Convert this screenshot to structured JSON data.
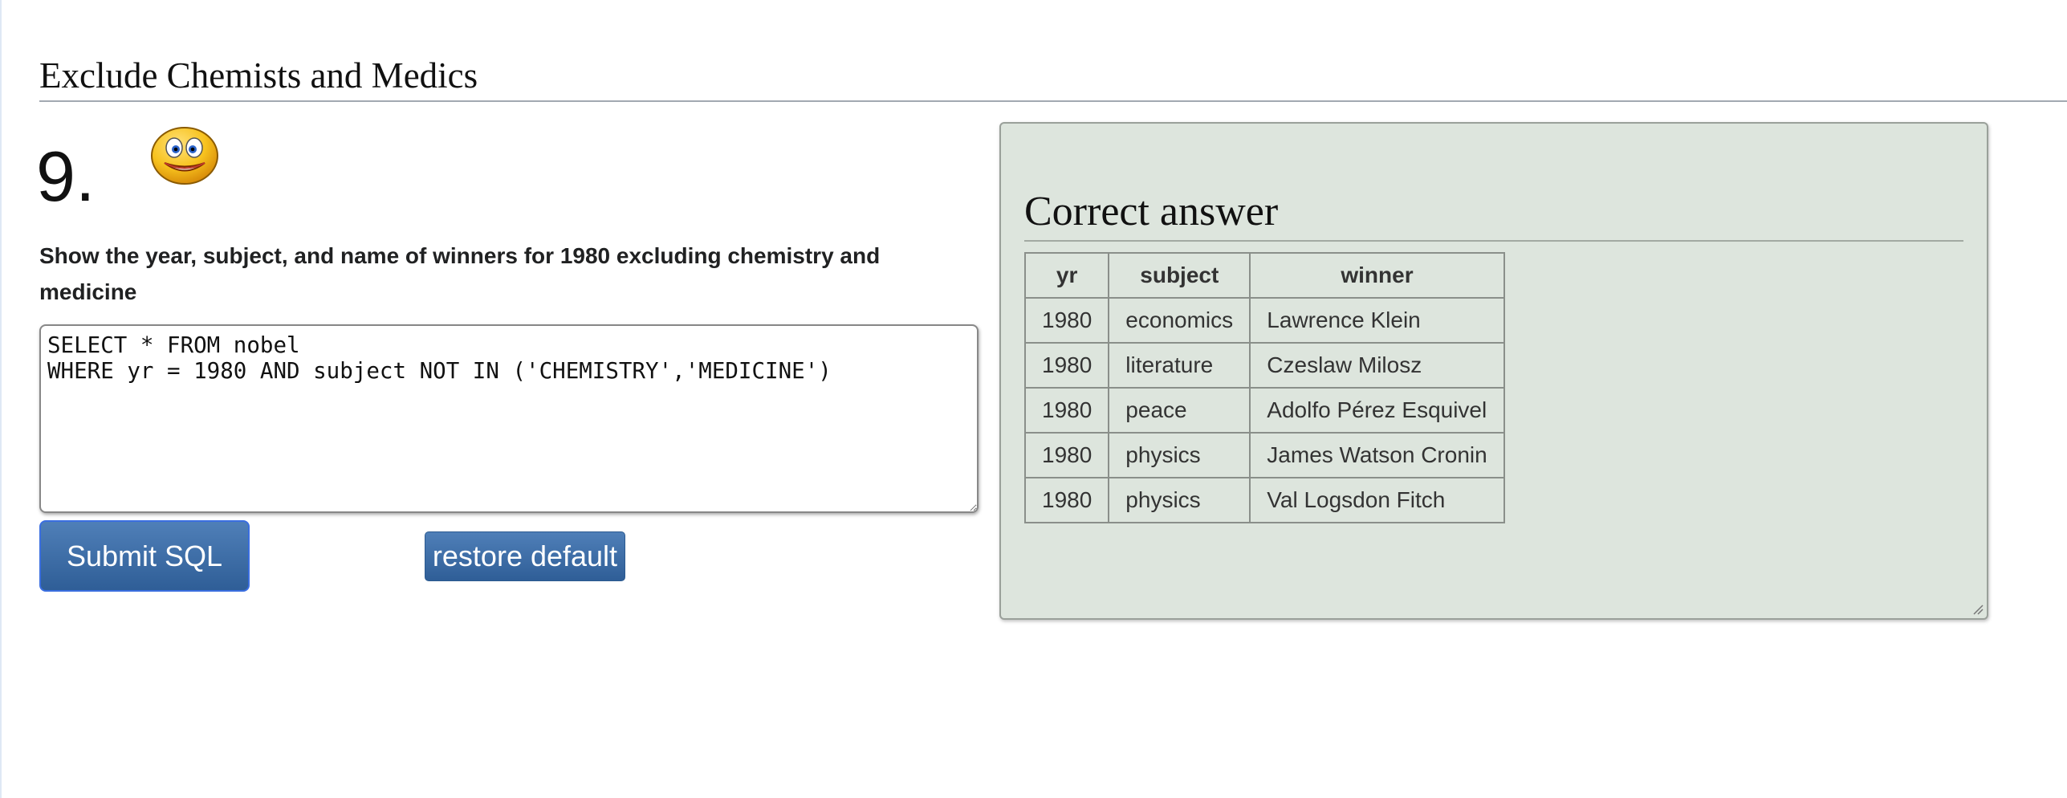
{
  "section": {
    "title": "Exclude Chemists and Medics"
  },
  "question": {
    "number": "9.",
    "status_icon": "grinning-smiley-icon",
    "text": "Show the year, subject, and name of winners for 1980 excluding chemistry and medicine"
  },
  "editor": {
    "sql": "SELECT * FROM nobel\nWHERE yr = 1980 AND subject NOT IN ('CHEMISTRY','MEDICINE')"
  },
  "buttons": {
    "submit_label": "Submit SQL",
    "restore_label": "restore default"
  },
  "answer": {
    "title": "Correct answer",
    "columns": [
      "yr",
      "subject",
      "winner"
    ],
    "rows": [
      [
        "1980",
        "economics",
        "Lawrence Klein"
      ],
      [
        "1980",
        "literature",
        "Czeslaw Milosz"
      ],
      [
        "1980",
        "peace",
        "Adolfo Pérez Esquivel"
      ],
      [
        "1980",
        "physics",
        "James Watson Cronin"
      ],
      [
        "1980",
        "physics",
        "Val Logsdon Fitch"
      ]
    ]
  },
  "colors": {
    "button": "#3b6aa3",
    "answer_panel": "#dde5dd",
    "smiley_face": "#f7c21e"
  }
}
